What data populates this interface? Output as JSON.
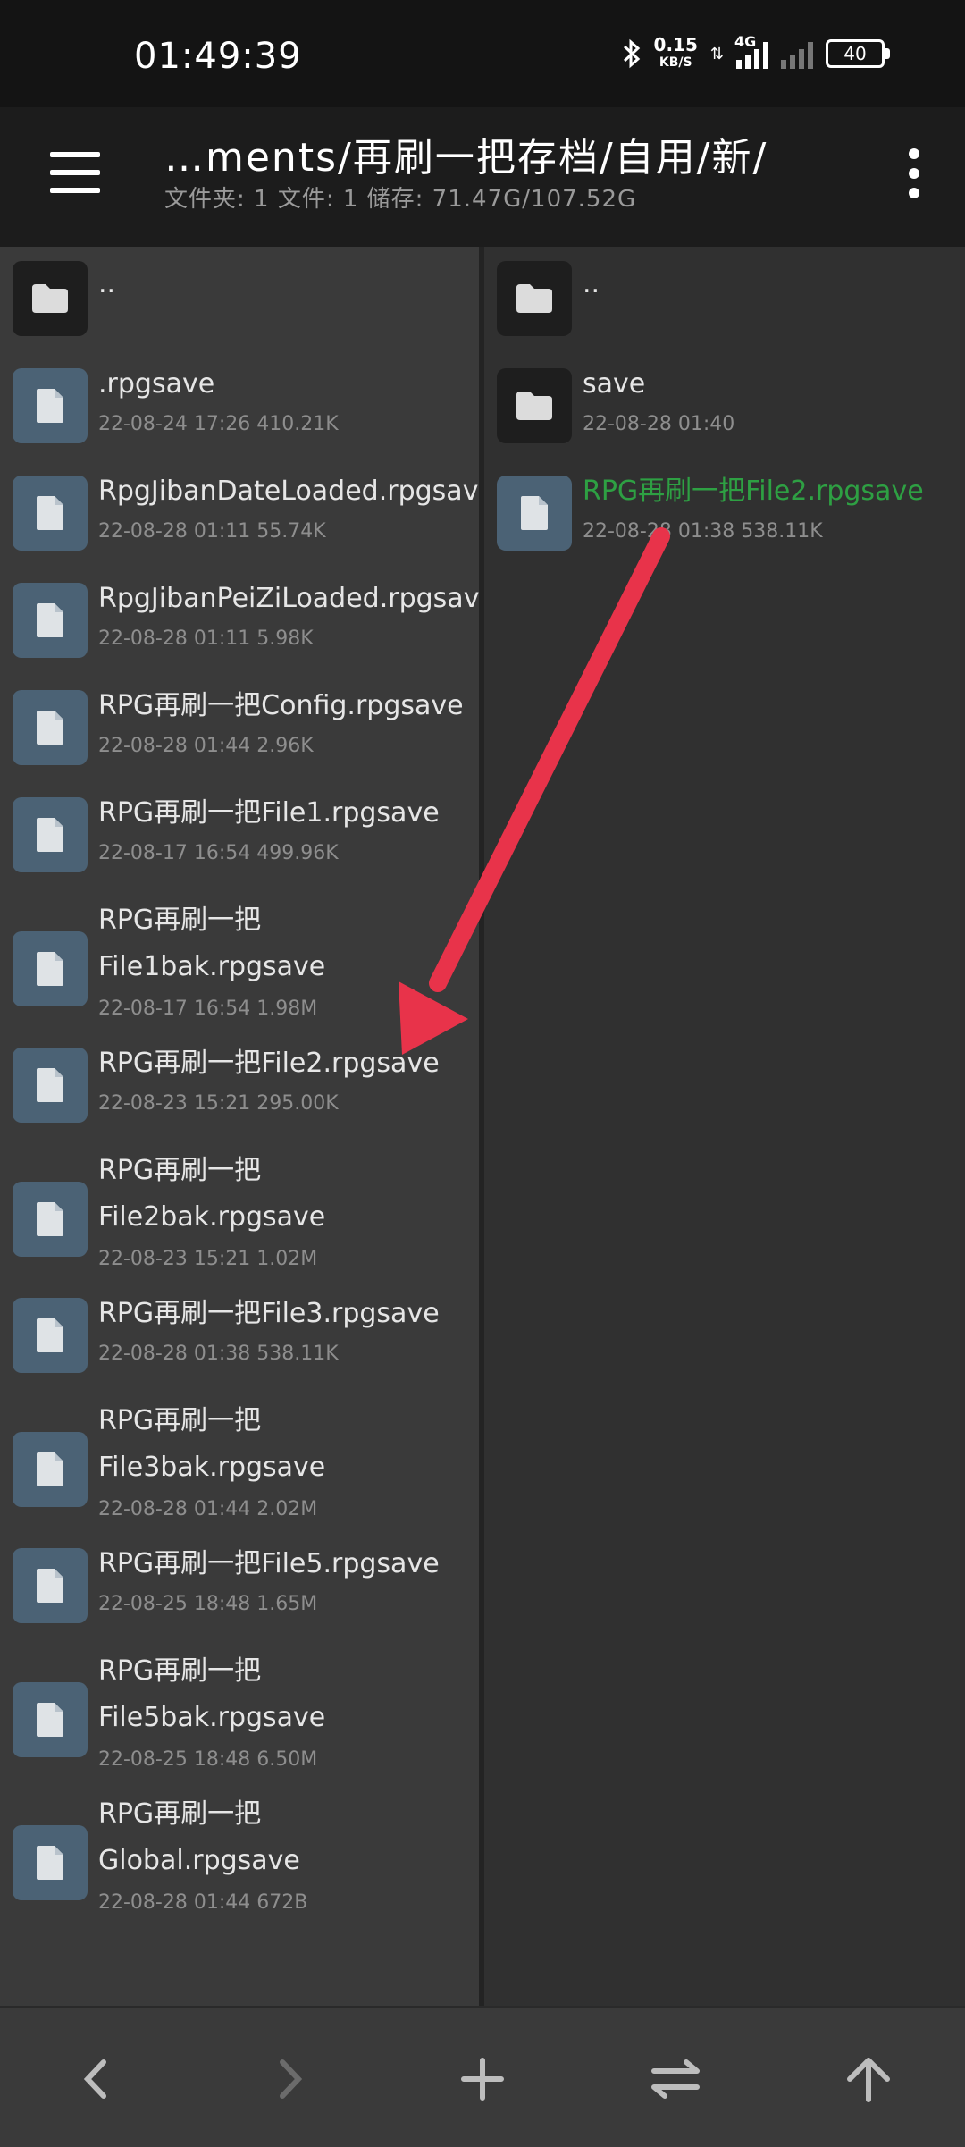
{
  "status": {
    "time": "01:49:39",
    "net_speed": "0.15",
    "net_unit": "KB/S",
    "network_type": "4G",
    "battery": "40"
  },
  "toolbar": {
    "path": "…ments/再刷一把存档/自用/新/",
    "info": "文件夹: 1   文件: 1   储存: 71.47G/107.52G"
  },
  "left_pane": {
    "items": [
      {
        "type": "folder-icon",
        "name": "..",
        "meta": ""
      },
      {
        "type": "file-icon",
        "name": ".rpgsave",
        "meta": "22-08-24 17:26 410.21K"
      },
      {
        "type": "file-icon",
        "name": "RpgJibanDateLoaded.rpgsave",
        "meta": "22-08-28 01:11 55.74K"
      },
      {
        "type": "file-icon",
        "name": "RpgJibanPeiZiLoaded.rpgsave",
        "meta": "22-08-28 01:11 5.98K"
      },
      {
        "type": "file-icon",
        "name": "RPG再刷一把Config.rpgsave",
        "meta": "22-08-28 01:44 2.96K"
      },
      {
        "type": "file-icon",
        "name": "RPG再刷一把File1.rpgsave",
        "meta": "22-08-17 16:54 499.96K"
      },
      {
        "type": "file-icon",
        "name": "RPG再刷一把",
        "name2": "File1bak.rpgsave",
        "meta": "22-08-17 16:54 1.98M"
      },
      {
        "type": "file-icon",
        "name": "RPG再刷一把File2.rpgsave",
        "meta": "22-08-23 15:21 295.00K"
      },
      {
        "type": "file-icon",
        "name": "RPG再刷一把",
        "name2": "File2bak.rpgsave",
        "meta": "22-08-23 15:21 1.02M"
      },
      {
        "type": "file-icon",
        "name": "RPG再刷一把File3.rpgsave",
        "meta": "22-08-28 01:38 538.11K"
      },
      {
        "type": "file-icon",
        "name": "RPG再刷一把",
        "name2": "File3bak.rpgsave",
        "meta": "22-08-28 01:44 2.02M"
      },
      {
        "type": "file-icon",
        "name": "RPG再刷一把File5.rpgsave",
        "meta": "22-08-25 18:48 1.65M"
      },
      {
        "type": "file-icon",
        "name": "RPG再刷一把",
        "name2": "File5bak.rpgsave",
        "meta": "22-08-25 18:48 6.50M"
      },
      {
        "type": "file-icon",
        "name": "RPG再刷一把",
        "name2": "Global.rpgsave",
        "meta": "22-08-28 01:44 672B"
      }
    ]
  },
  "right_pane": {
    "items": [
      {
        "type": "folder-icon",
        "name": "..",
        "meta": ""
      },
      {
        "type": "folder-icon",
        "name": "save",
        "meta": "22-08-28 01:40"
      },
      {
        "type": "file-icon",
        "name": "RPG再刷一把File2.rpgsave",
        "meta": "22-08-28 01:38 538.11K",
        "highlight": true
      }
    ]
  },
  "bottom_nav": {
    "back": "chevron-left-icon",
    "forward": "chevron-right-icon",
    "add": "plus-icon",
    "swap": "swap-icon",
    "up": "arrow-up-icon"
  },
  "colors": {
    "highlight": "#2ea043",
    "annotation": "#e8334a",
    "file_icon_bg": "#4b6275"
  }
}
